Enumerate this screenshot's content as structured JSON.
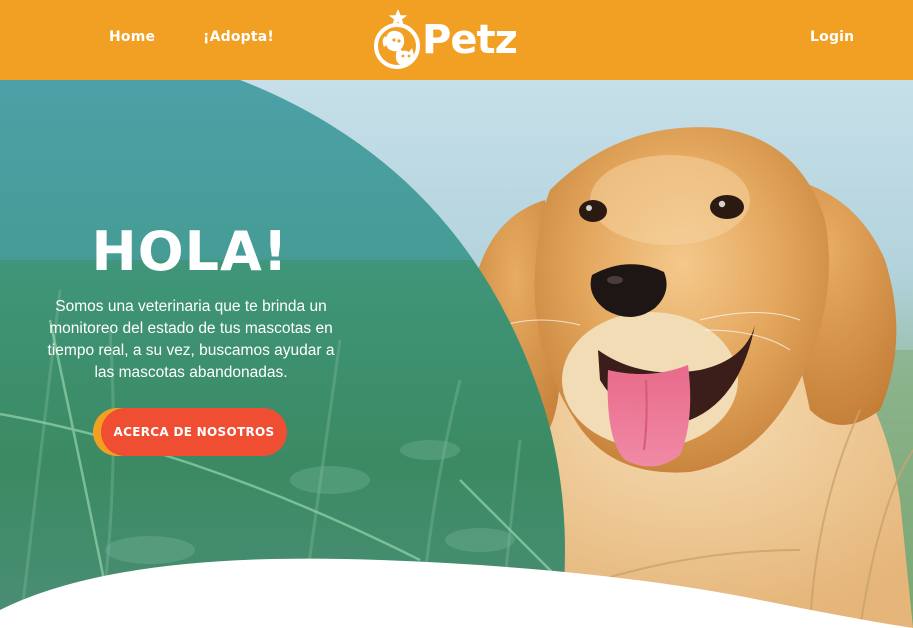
{
  "nav": {
    "home": "Home",
    "adopta": "¡Adopta!",
    "login": "Login"
  },
  "brand": {
    "name": "Petz",
    "logo_icon": "dog-cat-star-icon"
  },
  "hero": {
    "title": "HOLA!",
    "description": "Somos una veterinaria que te brinda un monitoreo del estado de tus mascotas en tiempo real, a su vez, buscamos ayudar a las mascotas abandonadas.",
    "cta_label": "ACERCA DE NOSOTROS",
    "image_subject": "golden-retriever-puppy-in-grass"
  },
  "colors": {
    "header_bg": "#f2a024",
    "cta_bg": "#f04e32",
    "cta_shadow": "#f2a024",
    "overlay_teal": "#3e9ea6",
    "text_light": "#ffffff"
  }
}
